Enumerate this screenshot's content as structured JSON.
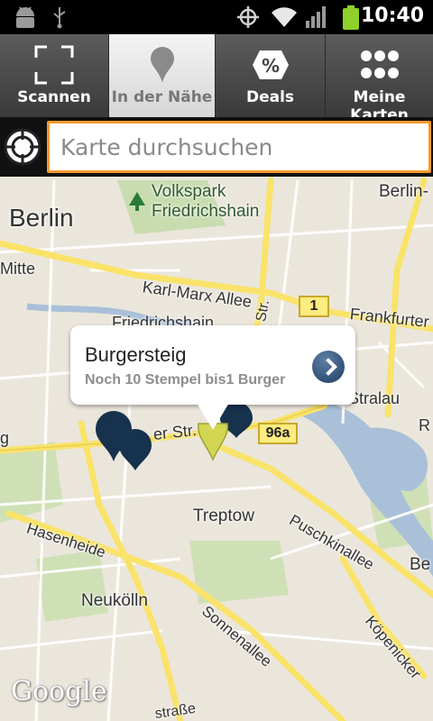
{
  "status_bar": {
    "time": "10:40",
    "icons": [
      "android-debug-icon",
      "usb-icon",
      "gps-icon",
      "wifi-icon",
      "signal-icon",
      "battery-icon"
    ]
  },
  "tabs": [
    {
      "label": "Scannen",
      "icon": "scan-frame-icon",
      "active": false
    },
    {
      "label": "In der Nähe",
      "icon": "map-pin-icon",
      "active": true
    },
    {
      "label": "Deals",
      "icon": "percent-badge-icon",
      "active": false
    },
    {
      "label": "Meine Karten",
      "icon": "grid-dots-icon",
      "active": false
    }
  ],
  "search": {
    "placeholder": "Karte durchsuchen",
    "accent": "#f29a2e"
  },
  "map": {
    "labels": {
      "berlin": "Berlin",
      "berlin_right": "Berlin-",
      "volkspark": "Volkspark",
      "friedrichshain": "Friedrichshain",
      "mitte": "Mitte",
      "karl_marx": "Karl-Marx Allee",
      "frankfurter": "Frankfurter",
      "friedrichshain2": "Friedrichshain",
      "str": "Str.",
      "er_str": "er Str.",
      "stralau": "Stralau",
      "treptow": "Treptow",
      "puschkinallee": "Puschkinallee",
      "hasenheide": "Hasenheide",
      "neukolln": "Neukölln",
      "sonnenallee": "Sonnenallee",
      "kopenicker": "Köpenicker",
      "strasse_bottom": "straße",
      "edge_g": "g",
      "edge_r": "R",
      "edge_be": "Be"
    },
    "route_badges": [
      "1",
      "96a"
    ],
    "marker_color": "#16324d",
    "selected_marker_color": "#d2d653",
    "callout": {
      "title": "Burgersteig",
      "subtitle": "Noch 10 Stempel bis1 Burger"
    },
    "attribution": "Google"
  }
}
